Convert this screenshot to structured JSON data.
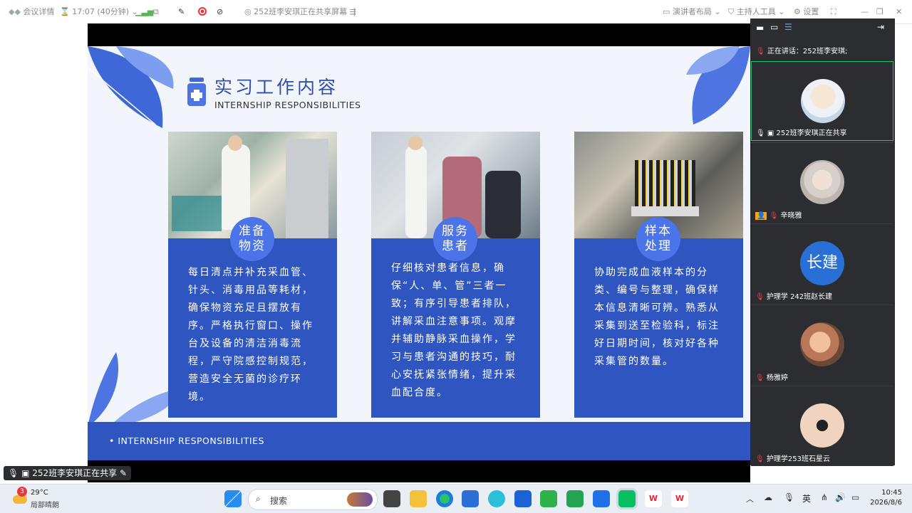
{
  "topbar": {
    "meeting_details": "会议详情",
    "timer": "17:07 (40分钟)",
    "sharing_status": "252班李安琪正在共享屏幕",
    "speaker_layout": "演讲者布局",
    "host_tools": "主持人工具",
    "settings": "设置"
  },
  "slide": {
    "title": "实习工作内容",
    "subtitle": "INTERNSHIP RESPONSIBILITIES",
    "footer_text": "• INTERNSHIP RESPONSIBILITIES",
    "cards": [
      {
        "badge": [
          "准备",
          "物资"
        ],
        "text": "每日清点并补充采血管、针头、消毒用品等耗材，确保物资充足且摆放有序。严格执行窗口、操作台及设备的清洁消毒流程，严守院感控制规范，营造安全无菌的诊疗环境。"
      },
      {
        "badge": [
          "服务",
          "患者"
        ],
        "text": "仔细核对患者信息，确保“人、单、管”三者一致；有序引导患者排队，讲解采血注意事项。观摩并辅助静脉采血操作，学习与患者沟通的技巧，耐心安抚紧张情绪，提升采血配合度。"
      },
      {
        "badge": [
          "样本",
          "处理"
        ],
        "text": "协助完成血液样本的分类、编号与整理，确保样本信息清晰可辨。熟悉从采集到送至检验科，标注好日期时间，核对好各种采集管的数量。"
      }
    ]
  },
  "bottom_share_label": "252班李安琪正在共享",
  "panel": {
    "speaking_now": "正在讲话：252班李安琪;",
    "participants": [
      {
        "name": "252班李安琪正在共享",
        "avatar_text": ""
      },
      {
        "name": "辛晓雅",
        "avatar_text": ""
      },
      {
        "name": "护理学 242班赵长建",
        "avatar_text": "长建"
      },
      {
        "name": "杨雅婷",
        "avatar_text": ""
      },
      {
        "name": "护理学253班石星云",
        "avatar_text": ""
      }
    ]
  },
  "taskbar": {
    "weather_temp": "29°C",
    "weather_desc": "局部晴朗",
    "weather_badge": "3",
    "search_label": "搜索",
    "ime": "英",
    "time": "10:45",
    "date": "2026/8/6"
  }
}
